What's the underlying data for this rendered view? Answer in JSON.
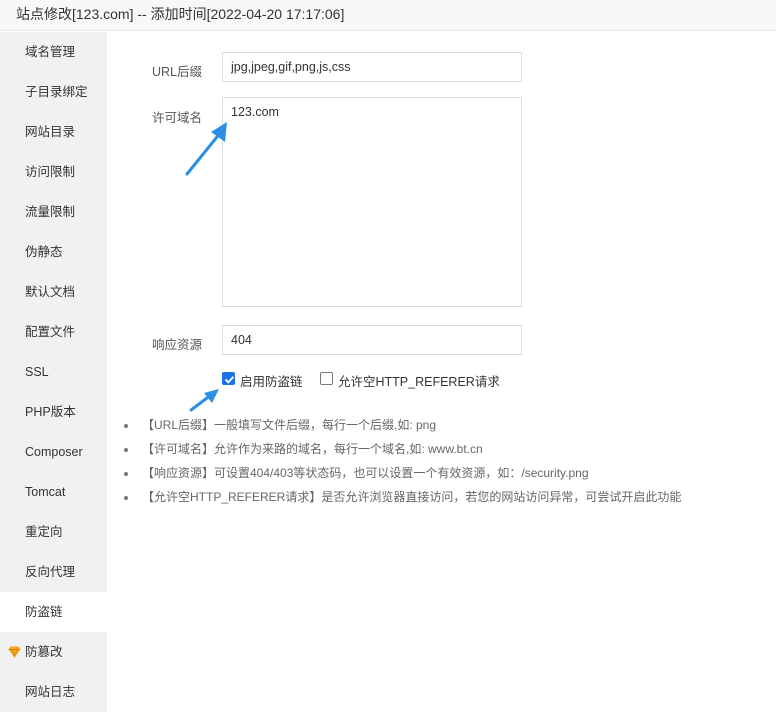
{
  "window": {
    "title": "站点修改[123.com] -- 添加时间[2022-04-20 17:17:06]"
  },
  "sidebar": {
    "items": [
      {
        "label": "域名管理"
      },
      {
        "label": "子目录绑定"
      },
      {
        "label": "网站目录"
      },
      {
        "label": "访问限制"
      },
      {
        "label": "流量限制"
      },
      {
        "label": "伪静态"
      },
      {
        "label": "默认文档"
      },
      {
        "label": "配置文件"
      },
      {
        "label": "SSL"
      },
      {
        "label": "PHP版本"
      },
      {
        "label": "Composer"
      },
      {
        "label": "Tomcat"
      },
      {
        "label": "重定向"
      },
      {
        "label": "反向代理"
      },
      {
        "label": "防盗链",
        "active": true
      },
      {
        "label": "防篡改",
        "icon": "vip-diamond-icon"
      },
      {
        "label": "网站日志"
      }
    ]
  },
  "form": {
    "url_suffix": {
      "label": "URL后缀",
      "value": "jpg,jpeg,gif,png,js,css"
    },
    "allowed_domains": {
      "label": "许可域名",
      "value": "123.com"
    },
    "response_resource": {
      "label": "响应资源",
      "value": "404"
    },
    "enable_hotlink": {
      "label": "启用防盗链",
      "checked": true
    },
    "allow_empty_referer": {
      "label": "允许空HTTP_REFERER请求",
      "checked": false
    }
  },
  "tips": [
    "【URL后缀】一般填写文件后缀，每行一个后缀,如: png",
    "【许可域名】允许作为来路的域名，每行一个域名,如: www.bt.cn",
    "【响应资源】可设置404/403等状态码，也可以设置一个有效资源，如：/security.png",
    "【允许空HTTP_REFERER请求】是否允许浏览器直接访问，若您的网站访问异常，可尝试开启此功能"
  ],
  "colors": {
    "accent": "#1a73e8",
    "annotation_arrow": "#2b8fe6",
    "sidebar_bg": "#f1f1f1",
    "vip_icon": "#f5a623"
  }
}
